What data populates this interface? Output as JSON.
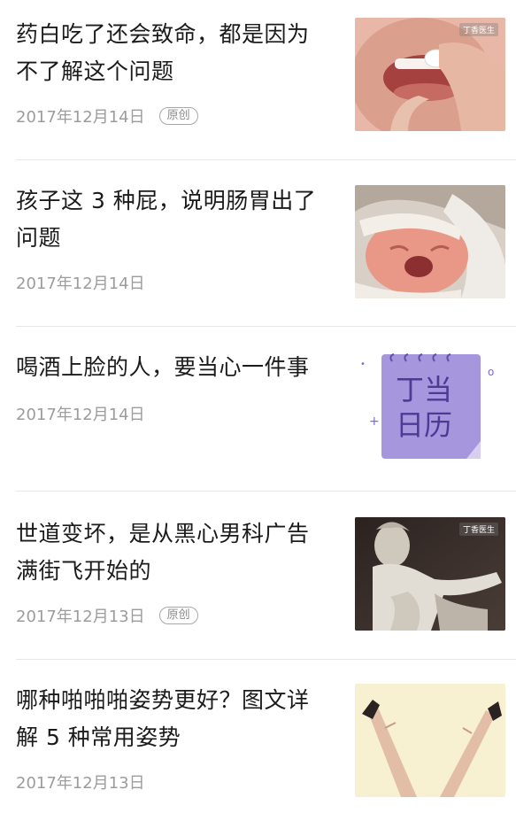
{
  "articles": [
    {
      "title_line1": "药白吃了还会致命，都是因为",
      "title_line2": "不了解这个问题",
      "date": "2017年12月14日",
      "badge": "原创",
      "thumb_icon": "pill-in-mouth-image",
      "watermark": "丁香医生"
    },
    {
      "title_line1": "孩子这 3 种屁，说明肠胃出了",
      "title_line2": "问题",
      "date": "2017年12月14日",
      "badge": "",
      "thumb_icon": "crying-baby-image",
      "watermark": ""
    },
    {
      "title_line1": "喝酒上脸的人，要当心一件事",
      "title_line2": "",
      "date": "2017年12月14日",
      "badge": "",
      "thumb_icon": "calendar-logo-image",
      "thumb_text_line1": "丁当",
      "thumb_text_line2": "日历",
      "watermark": ""
    },
    {
      "title_line1": "世道变坏，是从黑心男科广告",
      "title_line2": "满街飞开始的",
      "date": "2017年12月13日",
      "badge": "原创",
      "thumb_icon": "statue-image",
      "watermark": "丁香医生"
    },
    {
      "title_line1": "哪种啪啪啪姿势更好？图文详",
      "title_line2": "解 5 种常用姿势",
      "date": "2017年12月13日",
      "badge": "",
      "thumb_icon": "legs-image",
      "watermark": ""
    }
  ],
  "colors": {
    "title": "#1b1b1b",
    "meta": "#9c9c9c",
    "divider": "#e7e7e7",
    "calendar_purple": "#a596de"
  }
}
